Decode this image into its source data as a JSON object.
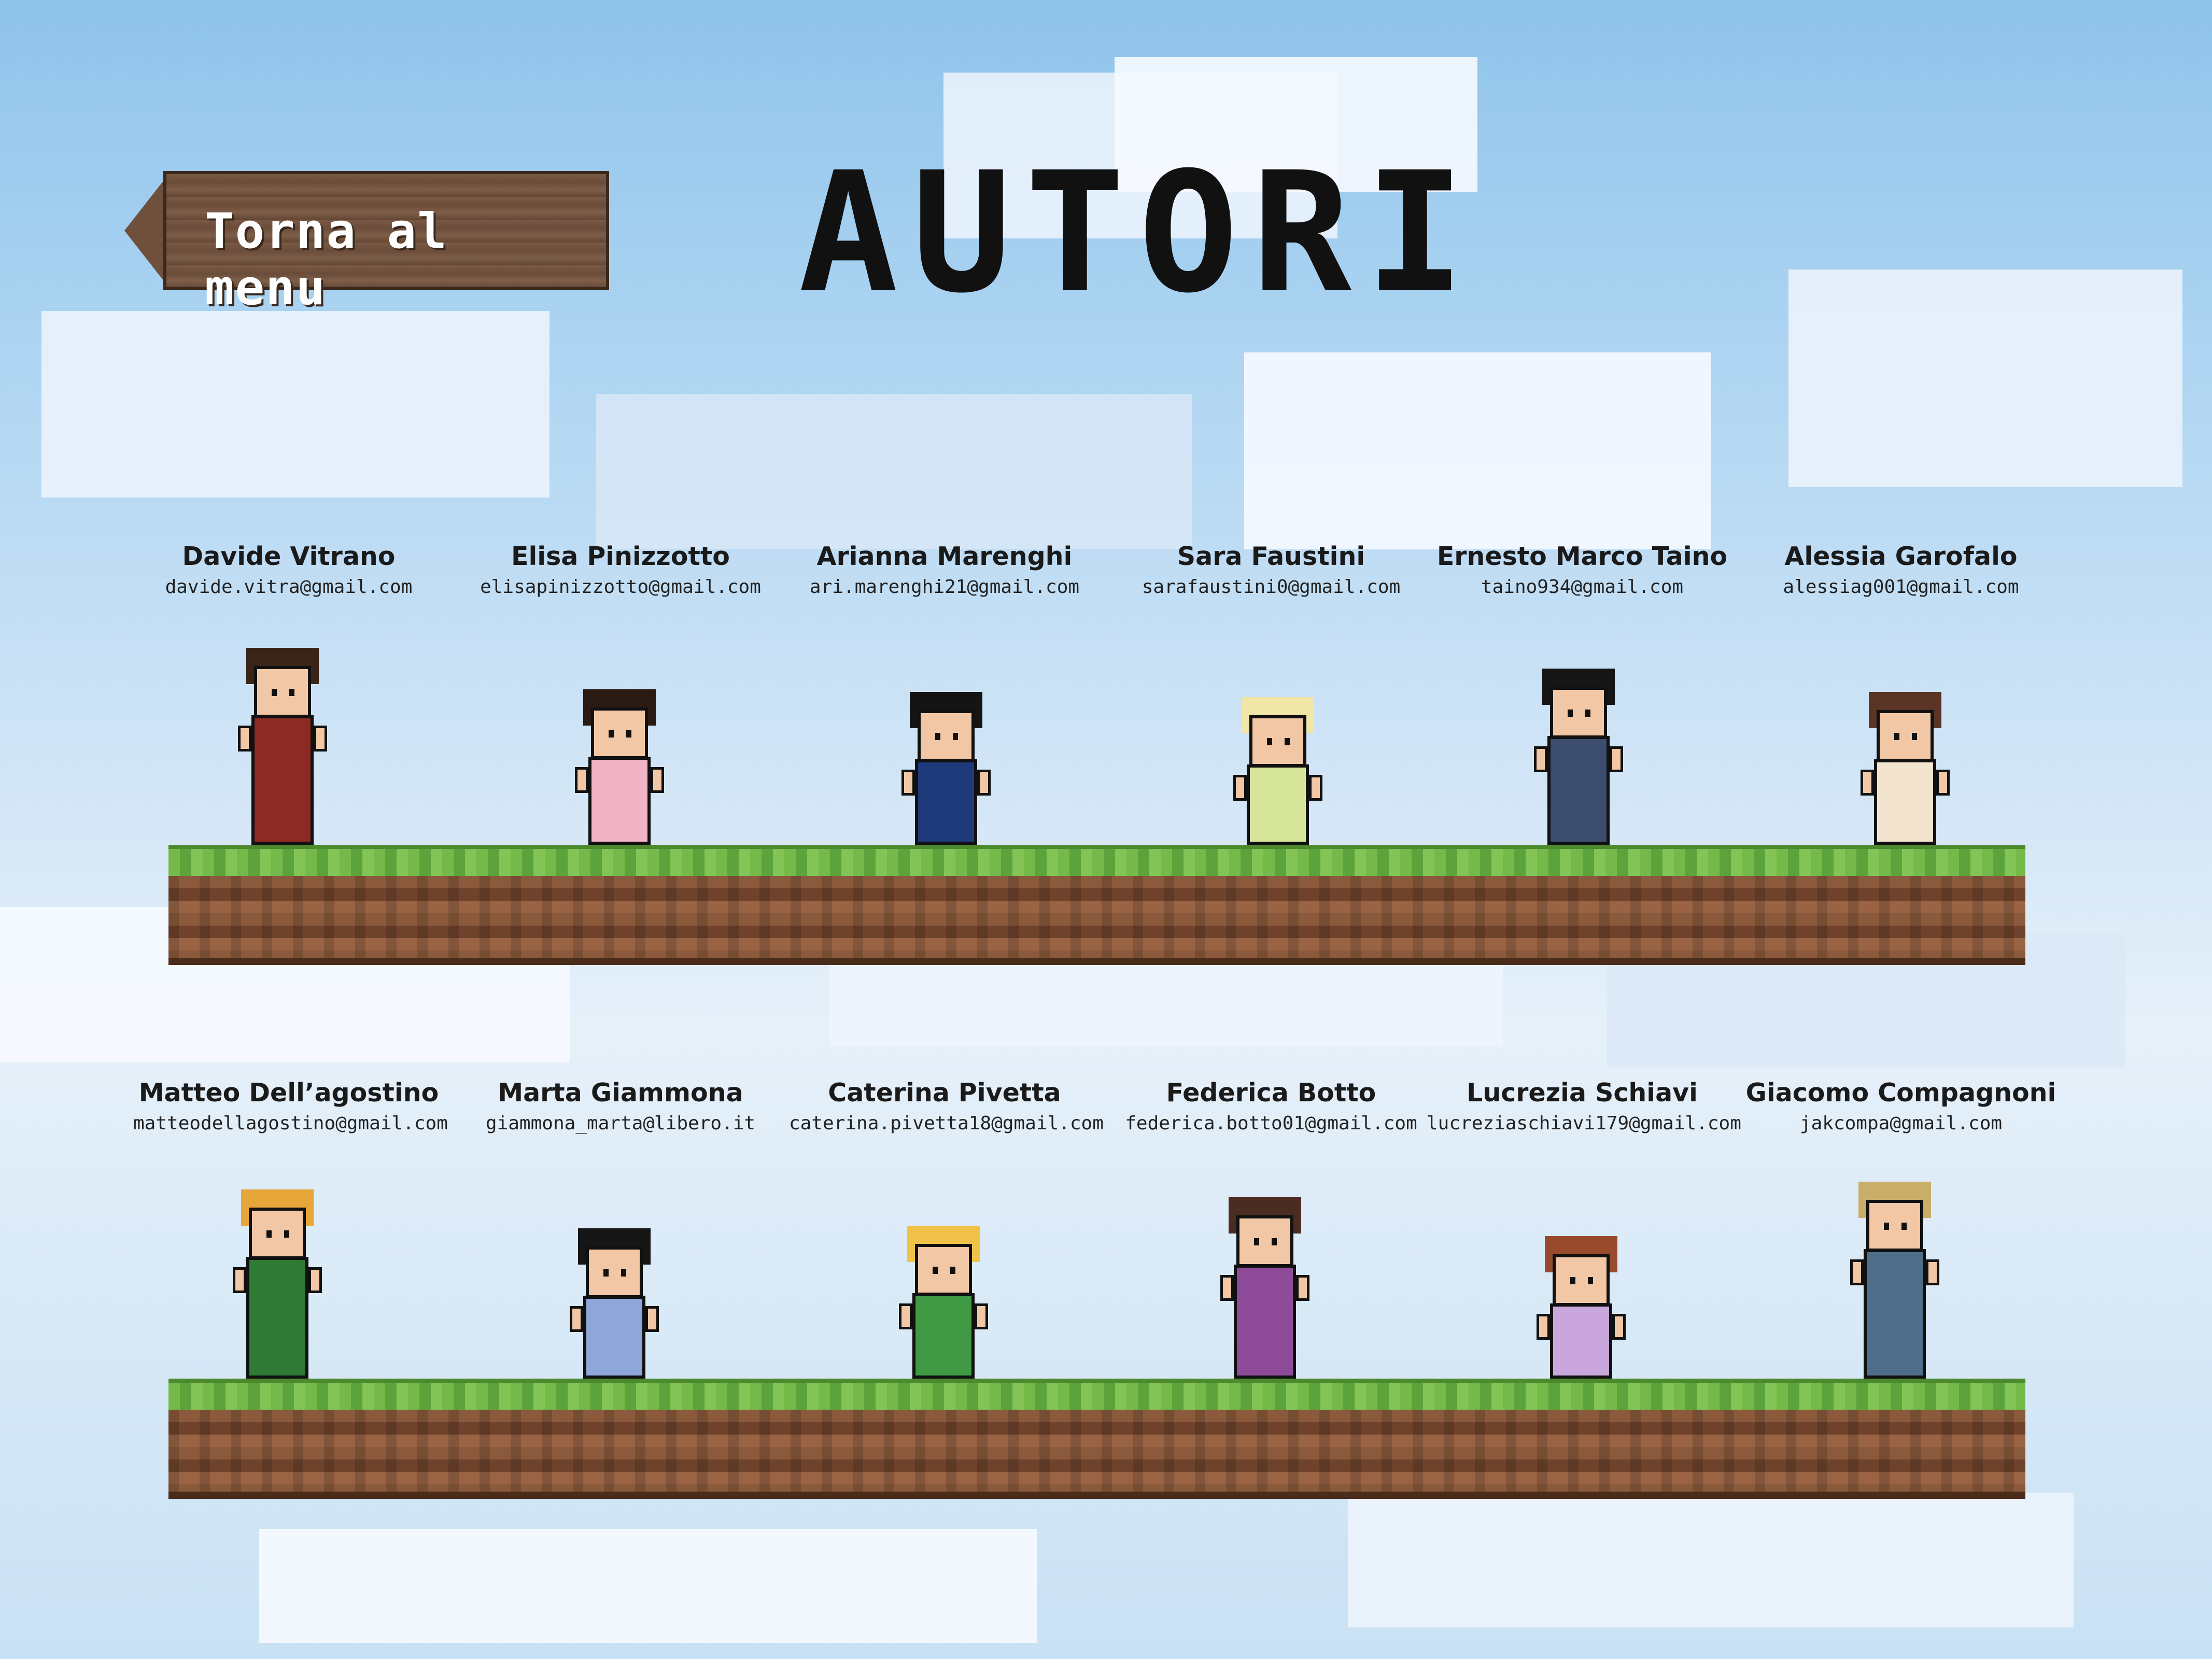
{
  "page": {
    "title": "AUTORI",
    "back_label": "Torna al menu"
  },
  "colors": {
    "sky_top": "#8fc3ea",
    "sky_bottom": "#e6f0f9",
    "grass": "#74b94a",
    "dirt": "#8b5a3c",
    "sign_wood": "#6e503d"
  },
  "authors_row1": [
    {
      "name": "Davide Vitrano",
      "email": "davide.vitra@gmail.com",
      "hair": "#3a2418",
      "outfit": "#8e2a24"
    },
    {
      "name": "Elisa Pinizzotto",
      "email": "elisapinizzotto@gmail.com",
      "hair": "#2a1a14",
      "outfit": "#f1b3c6"
    },
    {
      "name": "Arianna Marenghi",
      "email": "ari.marenghi21@gmail.com",
      "hair": "#141414",
      "outfit": "#1f3a7a"
    },
    {
      "name": "Sara Faustini",
      "email": "sarafaustini0@gmail.com",
      "hair": "#f0e6a6",
      "outfit": "#d7e69a"
    },
    {
      "name": "Ernesto Marco Taino",
      "email": "taino934@gmail.com",
      "hair": "#151515",
      "outfit": "#3d4d6e"
    },
    {
      "name": "Alessia Garofalo",
      "email": "alessiag001@gmail.com",
      "hair": "#5a3424",
      "outfit": "#f3e4cf"
    }
  ],
  "authors_row2": [
    {
      "name": "Matteo Dell’agostino",
      "email": "matteodellagostino@gmail.com",
      "hair": "#e6a63a",
      "outfit": "#2f7a34"
    },
    {
      "name": "Marta Giammona",
      "email": "giammona_marta@libero.it",
      "hair": "#161616",
      "outfit": "#8fa6d8"
    },
    {
      "name": "Caterina Pivetta",
      "email": "caterina.pivetta18@gmail.com",
      "hair": "#f0c24a",
      "outfit": "#3f9a43"
    },
    {
      "name": "Federica Botto",
      "email": "federica.botto01@gmail.com",
      "hair": "#4a2c22",
      "outfit": "#8d4b9a"
    },
    {
      "name": "Lucrezia Schiavi",
      "email": "lucreziaschiavi179@gmail.com",
      "hair": "#9a4a2c",
      "outfit": "#c9a6dc"
    },
    {
      "name": "Giacomo Compagnoni",
      "email": "jakcompa@gmail.com",
      "hair": "#c9ae6a",
      "outfit": "#4f6e8a"
    }
  ]
}
